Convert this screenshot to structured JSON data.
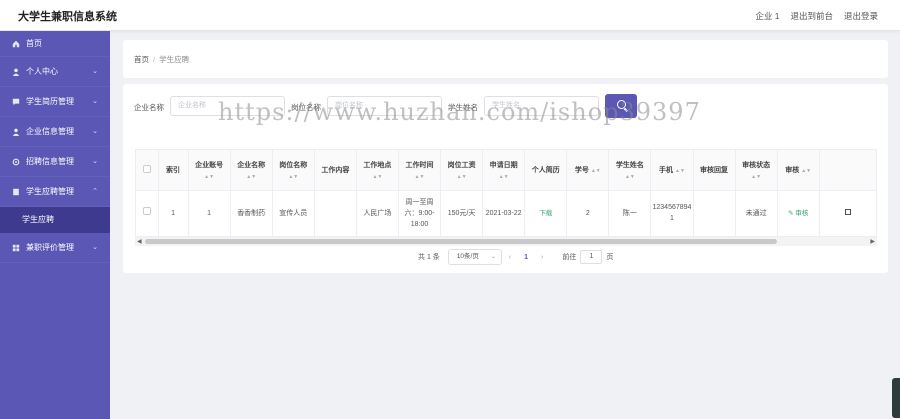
{
  "app": {
    "title": "大学生兼职信息系统"
  },
  "top_links": {
    "user": "企业 1",
    "front": "退出到前台",
    "logout": "退出登录"
  },
  "sidebar": {
    "items": [
      {
        "label": "首页",
        "icon": "home-icon"
      },
      {
        "label": "个人中心",
        "icon": "user-icon"
      },
      {
        "label": "学生简历管理",
        "icon": "chat-icon"
      },
      {
        "label": "企业信息管理",
        "icon": "user-icon"
      },
      {
        "label": "招聘信息管理",
        "icon": "gear-icon"
      },
      {
        "label": "学生应聘管理",
        "icon": "doc-icon"
      },
      {
        "label": "兼职评价管理",
        "icon": "grid-icon"
      }
    ],
    "active_sub": "学生应聘"
  },
  "breadcrumb": {
    "home": "首页",
    "current": "学生应聘"
  },
  "filters": {
    "company_label": "企业名称",
    "company_placeholder": "企业名称",
    "position_label": "岗位名称",
    "position_placeholder": "岗位名称",
    "student_label": "学生姓名",
    "student_placeholder": "学生姓名"
  },
  "table": {
    "headers": [
      "",
      "索引",
      "企业账号",
      "企业名称",
      "岗位名称",
      "工作内容",
      "工作地点",
      "工作时间",
      "岗位工资",
      "申请日期",
      "个人简历",
      "学号",
      "学生姓名",
      "手机",
      "审核回复",
      "审核状态",
      "审核",
      ""
    ],
    "row": {
      "index": "1",
      "account": "1",
      "company": "香香制药",
      "position": "宣传人员",
      "content": "",
      "location": "人民广场",
      "time": "周一至周六：9:00-18:00",
      "salary": "150元/天",
      "date": "2021-03-22",
      "resume": "下载",
      "student_no": "2",
      "student_name": "陈一",
      "phone": "12345678941",
      "reply": "",
      "status": "未通过",
      "audit": "审核"
    }
  },
  "pager": {
    "total": "共 1 条",
    "size": "10条/页",
    "page": "1",
    "goto": "前往",
    "goto_val": "1",
    "page_suffix": "页"
  },
  "watermark": "https://www.huzhan.com/ishop39397",
  "colors": {
    "accent": "#5a57b5",
    "sidebar_bg": "#5a57b5",
    "sidebar_active": "#3d3a8f",
    "link_green": "#3aa36b"
  }
}
